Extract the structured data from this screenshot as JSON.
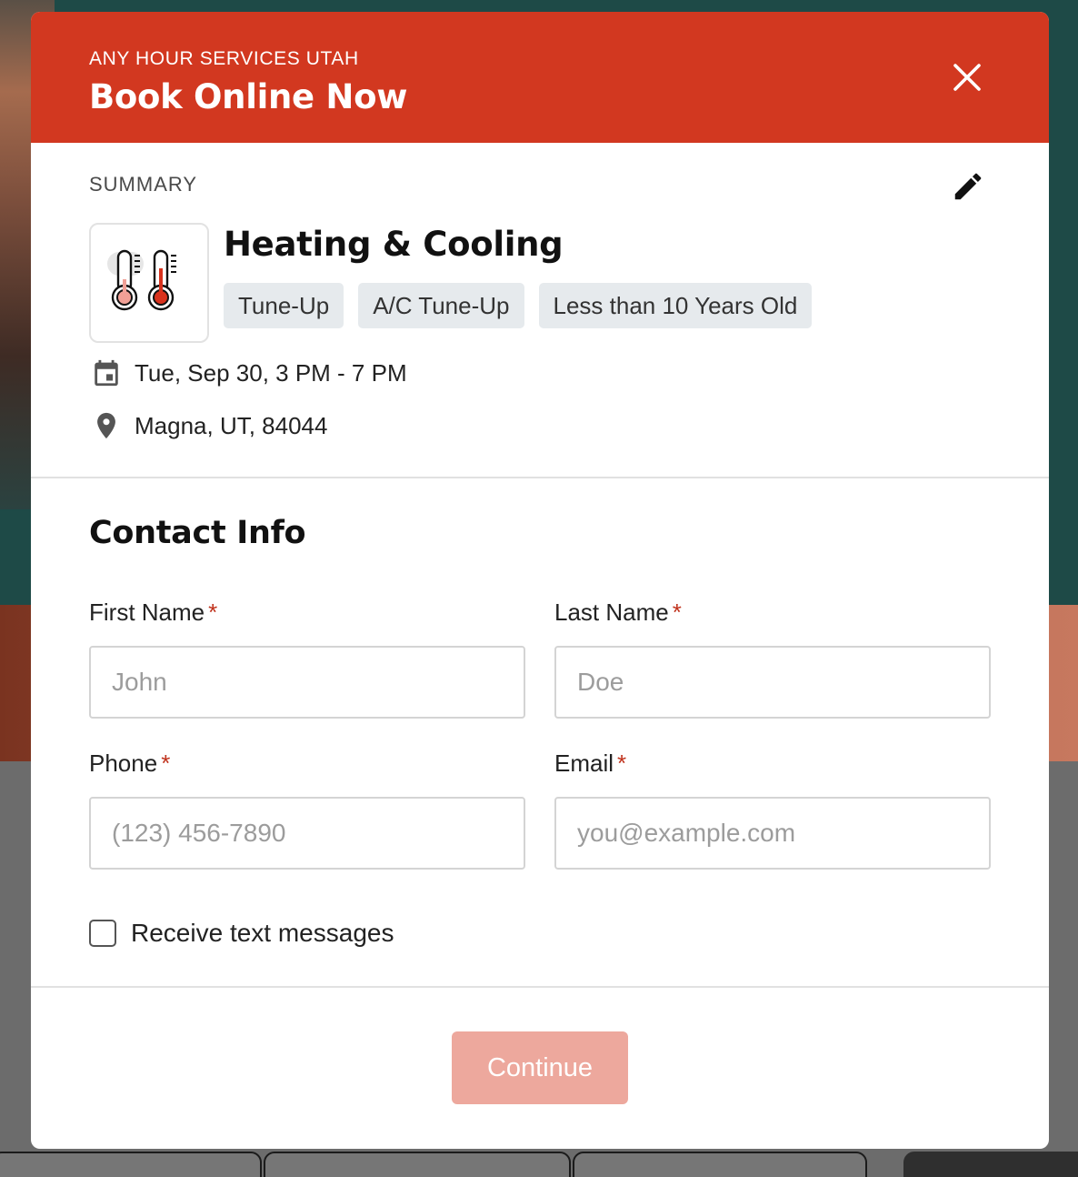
{
  "modal": {
    "brand": "ANY HOUR SERVICES UTAH",
    "title": "Book Online Now",
    "close_icon": "close-icon",
    "header_color": "#d23820"
  },
  "summary": {
    "label": "SUMMARY",
    "edit_icon": "pencil-icon",
    "service_icon": "thermometer-icon",
    "service_name": "Heating & Cooling",
    "tags": [
      "Tune-Up",
      "A/C Tune-Up",
      "Less than 10 Years Old"
    ],
    "date": "Tue, Sep 30, 3 PM - 7 PM",
    "date_icon": "calendar-icon",
    "location": "Magna, UT, 84044",
    "location_icon": "map-pin-icon"
  },
  "contact": {
    "title": "Contact Info",
    "required_mark": "*",
    "first_name": {
      "label": "First Name",
      "placeholder": "John",
      "value": ""
    },
    "last_name": {
      "label": "Last Name",
      "placeholder": "Doe",
      "value": ""
    },
    "phone": {
      "label": "Phone",
      "placeholder": "(123) 456-7890",
      "value": ""
    },
    "email": {
      "label": "Email",
      "placeholder": "you@example.com",
      "value": ""
    },
    "sms_checkbox": {
      "label": "Receive text messages",
      "checked": false
    }
  },
  "footer": {
    "continue_label": "Continue",
    "continue_color": "#eda89d"
  }
}
